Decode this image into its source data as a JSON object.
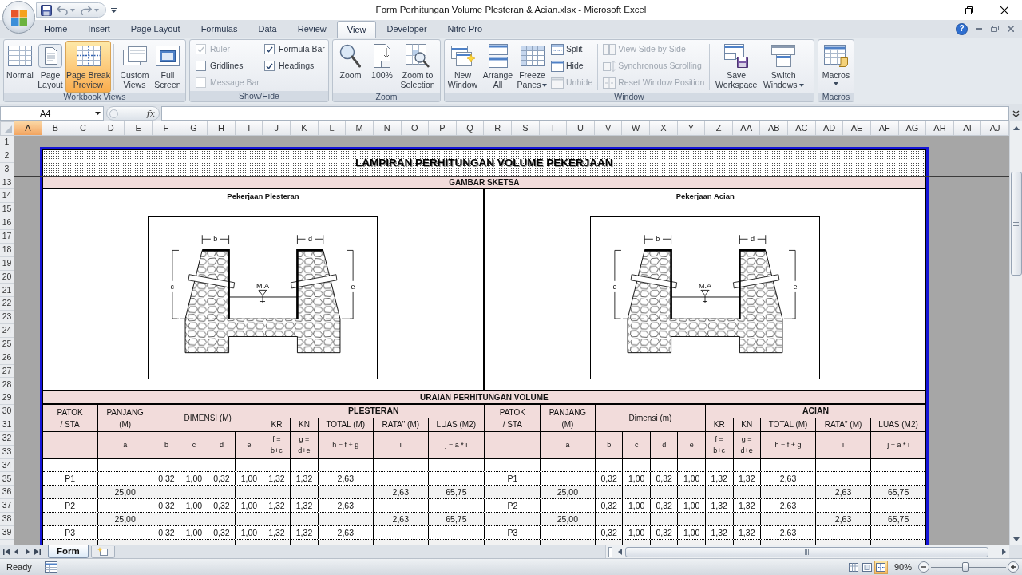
{
  "window": {
    "title": "Form Perhitungan Volume Plesteran & Acian.xlsx - Microsoft Excel",
    "help_button": "?"
  },
  "ribbon_tabs": [
    {
      "label": "Home",
      "selected": false
    },
    {
      "label": "Insert",
      "selected": false
    },
    {
      "label": "Page Layout",
      "selected": false
    },
    {
      "label": "Formulas",
      "selected": false
    },
    {
      "label": "Data",
      "selected": false
    },
    {
      "label": "Review",
      "selected": false
    },
    {
      "label": "View",
      "selected": true
    },
    {
      "label": "Developer",
      "selected": false
    },
    {
      "label": "Nitro Pro",
      "selected": false
    }
  ],
  "ribbon_groups": [
    {
      "kind": "views",
      "label": "Workbook Views",
      "items": [
        {
          "label": "Normal",
          "selected": false
        },
        {
          "label": "Page\nLayout",
          "selected": false
        },
        {
          "label": "Page Break\nPreview",
          "selected": true
        },
        {
          "label": "Custom\nViews",
          "selected": false
        },
        {
          "label": "Full\nScreen",
          "selected": false
        }
      ]
    },
    {
      "kind": "checks",
      "label": "Show/Hide",
      "items": [
        {
          "label": "Ruler",
          "checked": true,
          "disabled": true
        },
        {
          "label": "Gridlines",
          "checked": false,
          "disabled": false
        },
        {
          "label": "Message Bar",
          "checked": false,
          "disabled": true
        },
        {
          "label": "Formula Bar",
          "checked": true,
          "disabled": false
        },
        {
          "label": "Headings",
          "checked": true,
          "disabled": false
        }
      ]
    },
    {
      "kind": "tools",
      "label": "Zoom",
      "items": [
        {
          "kind": "large",
          "label": "Zoom"
        },
        {
          "kind": "large",
          "label": "100%"
        },
        {
          "kind": "large",
          "label": "Zoom to\nSelection"
        }
      ]
    },
    {
      "kind": "tools",
      "label": "Window",
      "items": [
        {
          "kind": "large",
          "label": "New\nWindow",
          "dropdown": false,
          "disabled": false
        },
        {
          "kind": "large",
          "label": "Arrange\nAll",
          "dropdown": false,
          "disabled": false
        },
        {
          "kind": "large",
          "label": "Freeze\nPanes",
          "dropdown": true,
          "disabled": false
        },
        {
          "kind": "small",
          "label": "Split",
          "dropdown": false,
          "disabled": false
        },
        {
          "kind": "small",
          "label": "Hide",
          "dropdown": false,
          "disabled": false
        },
        {
          "kind": "small",
          "label": "Unhide",
          "dropdown": false,
          "disabled": true
        },
        {
          "kind": "small",
          "label": "View Side by Side",
          "dropdown": false,
          "disabled": true
        },
        {
          "kind": "small",
          "label": "Synchronous Scrolling",
          "dropdown": false,
          "disabled": true
        },
        {
          "kind": "small",
          "label": "Reset Window Position",
          "dropdown": false,
          "disabled": true
        },
        {
          "kind": "large",
          "label": "Save\nWorkspace",
          "dropdown": false,
          "disabled": false
        },
        {
          "kind": "large",
          "label": "Switch\nWindows",
          "dropdown": true,
          "disabled": false
        }
      ]
    },
    {
      "kind": "tools",
      "label": "Macros",
      "items": [
        {
          "kind": "large",
          "label": "Macros",
          "dropdown": true
        }
      ]
    }
  ],
  "formula_bar": {
    "name_box": "A4",
    "function_button": "fx"
  },
  "column_headers": [
    {
      "label": "A",
      "selected": true
    },
    {
      "label": "B",
      "selected": false
    },
    {
      "label": "C",
      "selected": false
    },
    {
      "label": "D",
      "selected": false
    },
    {
      "label": "E",
      "selected": false
    },
    {
      "label": "F",
      "selected": false
    },
    {
      "label": "G",
      "selected": false
    },
    {
      "label": "H",
      "selected": false
    },
    {
      "label": "I",
      "selected": false
    },
    {
      "label": "J",
      "selected": false
    },
    {
      "label": "K",
      "selected": false
    },
    {
      "label": "L",
      "selected": false
    },
    {
      "label": "M",
      "selected": false
    },
    {
      "label": "N",
      "selected": false
    },
    {
      "label": "O",
      "selected": false
    },
    {
      "label": "P",
      "selected": false
    },
    {
      "label": "Q",
      "selected": false
    },
    {
      "label": "R",
      "selected": false
    },
    {
      "label": "S",
      "selected": false
    },
    {
      "label": "T",
      "selected": false
    },
    {
      "label": "U",
      "selected": false
    },
    {
      "label": "V",
      "selected": false
    },
    {
      "label": "W",
      "selected": false
    },
    {
      "label": "X",
      "selected": false
    },
    {
      "label": "Y",
      "selected": false
    },
    {
      "label": "Z",
      "selected": false
    },
    {
      "label": "AA",
      "selected": false
    },
    {
      "label": "AB",
      "selected": false
    },
    {
      "label": "AC",
      "selected": false
    },
    {
      "label": "AD",
      "selected": false
    },
    {
      "label": "AE",
      "selected": false
    },
    {
      "label": "AF",
      "selected": false
    },
    {
      "label": "AG",
      "selected": false
    },
    {
      "label": "AH",
      "selected": false
    },
    {
      "label": "AI",
      "selected": false
    },
    {
      "label": "AJ",
      "selected": false
    }
  ],
  "row_headers": [
    "1",
    "2",
    "3",
    "13",
    "14",
    "15",
    "16",
    "17",
    "18",
    "19",
    "20",
    "21",
    "22",
    "23",
    "24",
    "25",
    "26",
    "27",
    "28",
    "29",
    "30",
    "31",
    "32",
    "33",
    "34",
    "35",
    "36",
    "37",
    "38",
    "39"
  ],
  "sheet": {
    "title": "LAMPIRAN PERHITUNGAN VOLUME PEKERJAAN",
    "sketch_heading": "GAMBAR SKETSA",
    "sketches": [
      {
        "title": "Pekerjaan Plesteran",
        "dimension_labels": [
          "b",
          "d",
          "c",
          "e"
        ],
        "water_label": "M.A"
      },
      {
        "title": "Pekerjaan Acian",
        "dimension_labels": [
          "b",
          "d",
          "c",
          "e"
        ],
        "water_label": "M.A"
      }
    ],
    "calc_heading": "URAIAN PERHITUNGAN VOLUME",
    "sections": [
      {
        "patok": "PATOK\n/ STA",
        "panjang": "PANJANG\n(M)",
        "dimensi": "DIMENSI (M)",
        "group": "PLESTERAN",
        "columns": [
          "KR",
          "KN",
          "TOTAL (M)",
          "RATA\" (M)",
          "LUAS (M2)"
        ],
        "symbols": [
          "a",
          "b",
          "c",
          "d",
          "e",
          "f =\nb+c",
          "g =\nd+e",
          "h = f + g",
          "i",
          "j = a * i"
        ]
      },
      {
        "patok": "PATOK\n/ STA",
        "panjang": "PANJANG\n(M)",
        "dimensi": "Dimensi (m)",
        "group": "ACIAN",
        "columns": [
          "KR",
          "KN",
          "TOTAL (M)",
          "RATA\" (M)",
          "LUAS (M2)"
        ],
        "symbols": [
          "a",
          "b",
          "c",
          "d",
          "e",
          "f =\nb+c",
          "g =\nd+e",
          "h = f + g",
          "i",
          "j = a * i"
        ]
      }
    ],
    "rows": [
      {
        "shaded": false
      },
      {
        "shaded": false,
        "left": {
          "patok": "P1",
          "b": "0,32",
          "c": "1,00",
          "d": "0,32",
          "e": "1,00",
          "kr": "1,32",
          "kn": "1,32",
          "total": "2,63"
        },
        "right": {
          "patok": "P1",
          "b": "0,32",
          "c": "1,00",
          "d": "0,32",
          "e": "1,00",
          "kr": "1,32",
          "kn": "1,32",
          "total": "2,63"
        }
      },
      {
        "shaded": true,
        "left": {
          "panjang": "25,00",
          "rata": "2,63",
          "luas": "65,75"
        },
        "right": {
          "panjang": "25,00",
          "rata": "2,63",
          "luas": "65,75"
        }
      },
      {
        "shaded": false,
        "left": {
          "patok": "P2",
          "b": "0,32",
          "c": "1,00",
          "d": "0,32",
          "e": "1,00",
          "kr": "1,32",
          "kn": "1,32",
          "total": "2,63"
        },
        "right": {
          "patok": "P2",
          "b": "0,32",
          "c": "1,00",
          "d": "0,32",
          "e": "1,00",
          "kr": "1,32",
          "kn": "1,32",
          "total": "2,63"
        }
      },
      {
        "shaded": true,
        "left": {
          "panjang": "25,00",
          "rata": "2,63",
          "luas": "65,75"
        },
        "right": {
          "panjang": "25,00",
          "rata": "2,63",
          "luas": "65,75"
        }
      },
      {
        "shaded": false,
        "left": {
          "patok": "P3",
          "b": "0,32",
          "c": "1,00",
          "d": "0,32",
          "e": "1,00",
          "kr": "1,32",
          "kn": "1,32",
          "total": "2,63"
        },
        "right": {
          "patok": "P3",
          "b": "0,32",
          "c": "1,00",
          "d": "0,32",
          "e": "1,00",
          "kr": "1,32",
          "kn": "1,32",
          "total": "2,63"
        }
      },
      {
        "shaded": true
      }
    ]
  },
  "sheet_tabs": [
    {
      "label": "Form",
      "selected": true
    }
  ],
  "status_bar": {
    "status": "Ready",
    "view_buttons": [
      {
        "selected": false
      },
      {
        "selected": false
      },
      {
        "selected": true
      }
    ],
    "zoom": "90%",
    "zoom_slider": {
      "level": 0.46
    }
  }
}
